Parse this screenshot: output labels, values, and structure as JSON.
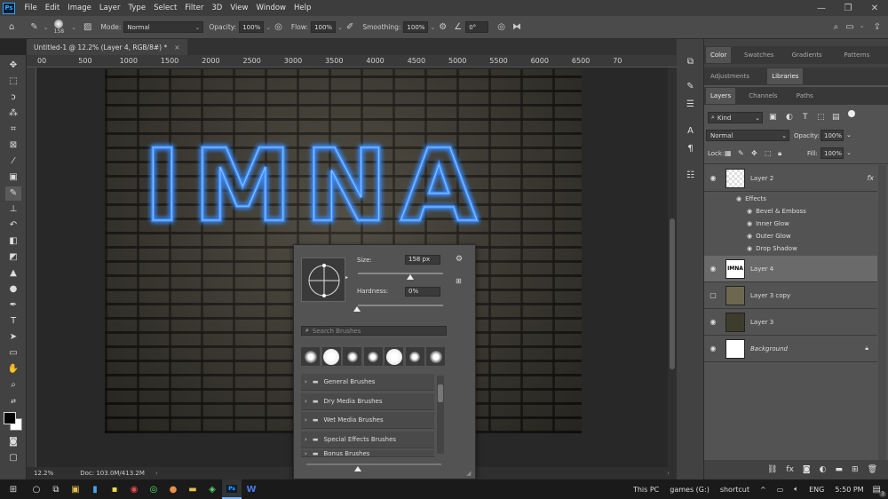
{
  "app": {
    "logo": "Ps"
  },
  "menu": [
    "File",
    "Edit",
    "Image",
    "Layer",
    "Type",
    "Select",
    "Filter",
    "3D",
    "View",
    "Window",
    "Help"
  ],
  "options": {
    "brush_size": "158",
    "mode_label": "Mode:",
    "mode_value": "Normal",
    "opacity_label": "Opacity:",
    "opacity_value": "100%",
    "flow_label": "Flow:",
    "flow_value": "100%",
    "smoothing_label": "Smoothing:",
    "smoothing_value": "100%",
    "angle_value": "0°"
  },
  "document": {
    "tab_title": "Untitled-1 @ 12.2% (Layer 4, RGB/8#) *",
    "close_symbol": "×",
    "canvas_text": "IMNA",
    "zoom": "12.2%",
    "doc_info": "Doc: 103.0M/413.2M"
  },
  "ruler_labels": [
    "00",
    "500",
    "1000",
    "1500",
    "2000",
    "2500",
    "3000",
    "3500",
    "4000",
    "4500",
    "5000",
    "5500",
    "6000",
    "6500",
    "70"
  ],
  "brush_popup": {
    "size_label": "Size:",
    "size_value": "158 px",
    "hardness_label": "Hardness:",
    "hardness_value": "0%",
    "search_placeholder": "Search Brushes",
    "folders": [
      "General Brushes",
      "Dry Media Brushes",
      "Wet Media Brushes",
      "Special Effects Brushes",
      "Bonus Brushes"
    ]
  },
  "panels": {
    "tabs_row1": [
      "Color",
      "Swatches",
      "Gradients",
      "Patterns"
    ],
    "tabs_row2": [
      "Adjustments",
      "Libraries"
    ],
    "tabs_row3": [
      "Layers",
      "Channels",
      "Paths"
    ],
    "kind_label": "Kind",
    "blend_mode": "Normal",
    "opacity_label": "Opacity:",
    "opacity_value": "100%",
    "lock_label": "Lock:",
    "fill_label": "Fill:",
    "fill_value": "100%"
  },
  "layers": [
    {
      "name": "Layer 2",
      "visible": true,
      "has_fx": true
    },
    {
      "name": "Layer 4",
      "visible": true,
      "selected": true
    },
    {
      "name": "Layer 3 copy",
      "visible": false
    },
    {
      "name": "Layer 3",
      "visible": true
    },
    {
      "name": "Background",
      "visible": true,
      "locked": true
    }
  ],
  "effects": {
    "header": "Effects",
    "items": [
      "Bevel & Emboss",
      "Inner Glow",
      "Outer Glow",
      "Drop Shadow"
    ],
    "fx_badge": "fx"
  },
  "taskbar": {
    "this_pc": "This PC",
    "games": "games (G:)",
    "shortcut": "shortcut",
    "lang": "ENG",
    "time": "5:50 PM",
    "notif_count": "3"
  },
  "colors": {
    "neon": "#2f7dff",
    "accent": "#31a8ff"
  }
}
